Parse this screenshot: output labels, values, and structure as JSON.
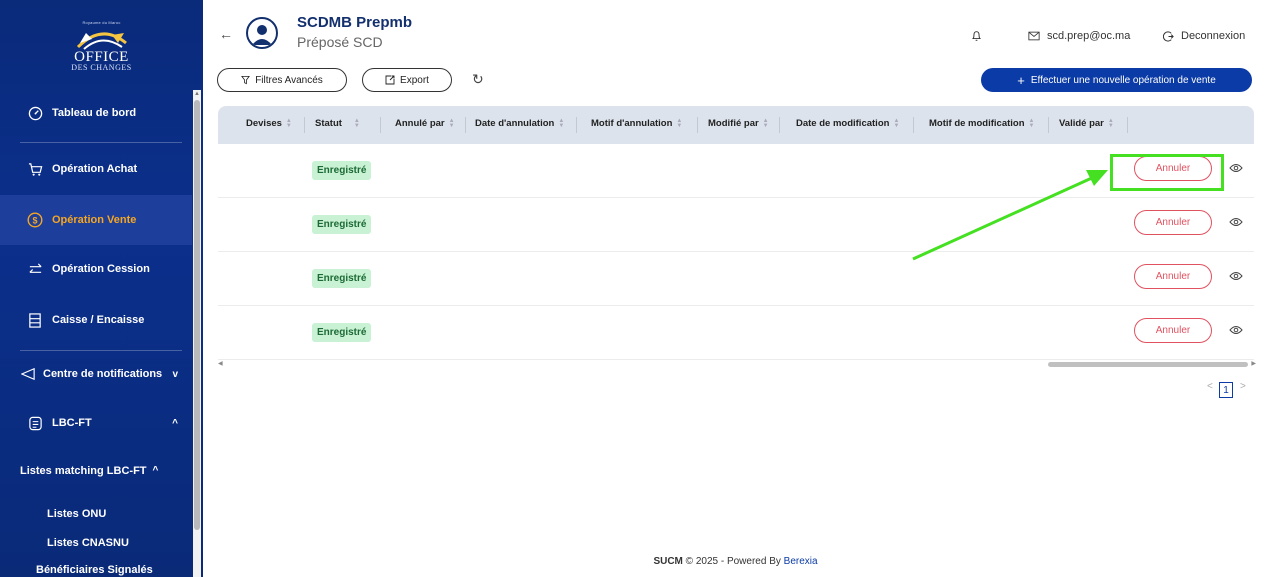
{
  "logo": {
    "kingdom": "Royaume du Maroc",
    "line1": "OFFICE",
    "line2": "DES CHANGES"
  },
  "sidebar": {
    "items": [
      {
        "label": "Tableau de bord",
        "icon": "gauge-icon"
      },
      {
        "label": "Opération Achat",
        "icon": "cart-icon"
      },
      {
        "label": "Opération Vente",
        "icon": "dollar-circle-icon",
        "active": true
      },
      {
        "label": "Opération Cession",
        "icon": "swap-icon"
      },
      {
        "label": "Caisse / Encaisse",
        "icon": "cash-register-icon"
      },
      {
        "label": "Centre de notifications",
        "icon": "send-icon",
        "chevron": "v"
      },
      {
        "label": "LBC-FT",
        "icon": "file-icon",
        "chevron": "^"
      }
    ],
    "sub_items": [
      {
        "label": "Listes matching LBC-FT",
        "chevron": "^"
      },
      {
        "label": "Listes ONU"
      },
      {
        "label": "Listes CNASNU"
      },
      {
        "label": "Bénéficiaires Signalés"
      }
    ]
  },
  "header": {
    "user_name": "SCDMB Prepmb",
    "user_role": "Préposé SCD",
    "email": "scd.prep@oc.ma",
    "logout": "Deconnexion"
  },
  "toolbar": {
    "filters": "Filtres Avancés",
    "export": "Export",
    "new_operation": "Effectuer une nouvelle opération de vente"
  },
  "table": {
    "columns": [
      "Devises",
      "Statut",
      "Annulé par",
      "Date d'annulation",
      "Motif d'annulation",
      "Modifié par",
      "Date de modification",
      "Motif de modification",
      "Validé par"
    ],
    "rows": [
      {
        "statut": "Enregistré",
        "action": "Annuler"
      },
      {
        "statut": "Enregistré",
        "action": "Annuler"
      },
      {
        "statut": "Enregistré",
        "action": "Annuler"
      },
      {
        "statut": "Enregistré",
        "action": "Annuler"
      }
    ]
  },
  "pagination": {
    "current": "1",
    "prev": "<",
    "next": ">"
  },
  "footer": {
    "brand": "SUCM",
    "copyright": "© 2025 - Powered By",
    "company": "Berexia"
  },
  "colors": {
    "sidebar": "#0a2a7a",
    "primary": "#0b3ba6",
    "active_text": "#f5a623",
    "danger": "#e05260",
    "success_bg": "#c9f1d4",
    "highlight": "#44e021"
  }
}
